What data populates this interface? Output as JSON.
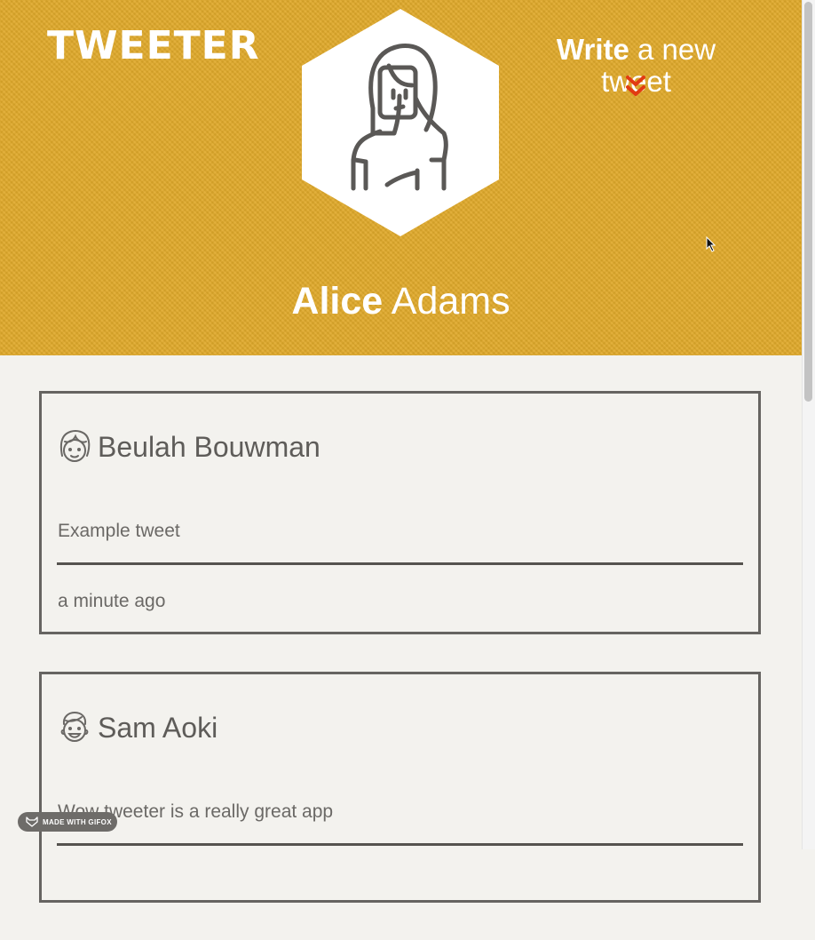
{
  "header": {
    "logo": "TWEETER",
    "compose": {
      "strong": "Write",
      "rest": " a new tweet"
    },
    "user": {
      "first_name": "Alice",
      "last_name": " Adams"
    },
    "background_color": "#e0a92a",
    "accent_color": "#e23b12"
  },
  "tweets": [
    {
      "author": "Beulah Bouwman",
      "content": "Example tweet",
      "timestamp": "a minute ago",
      "avatar_icon": "girl-face-icon"
    },
    {
      "author": "Sam Aoki",
      "content": "Wow tweeter is a really great app",
      "timestamp": "",
      "avatar_icon": "boy-face-icon"
    }
  ],
  "watermark": {
    "label": "MADE WITH GIFOX"
  }
}
